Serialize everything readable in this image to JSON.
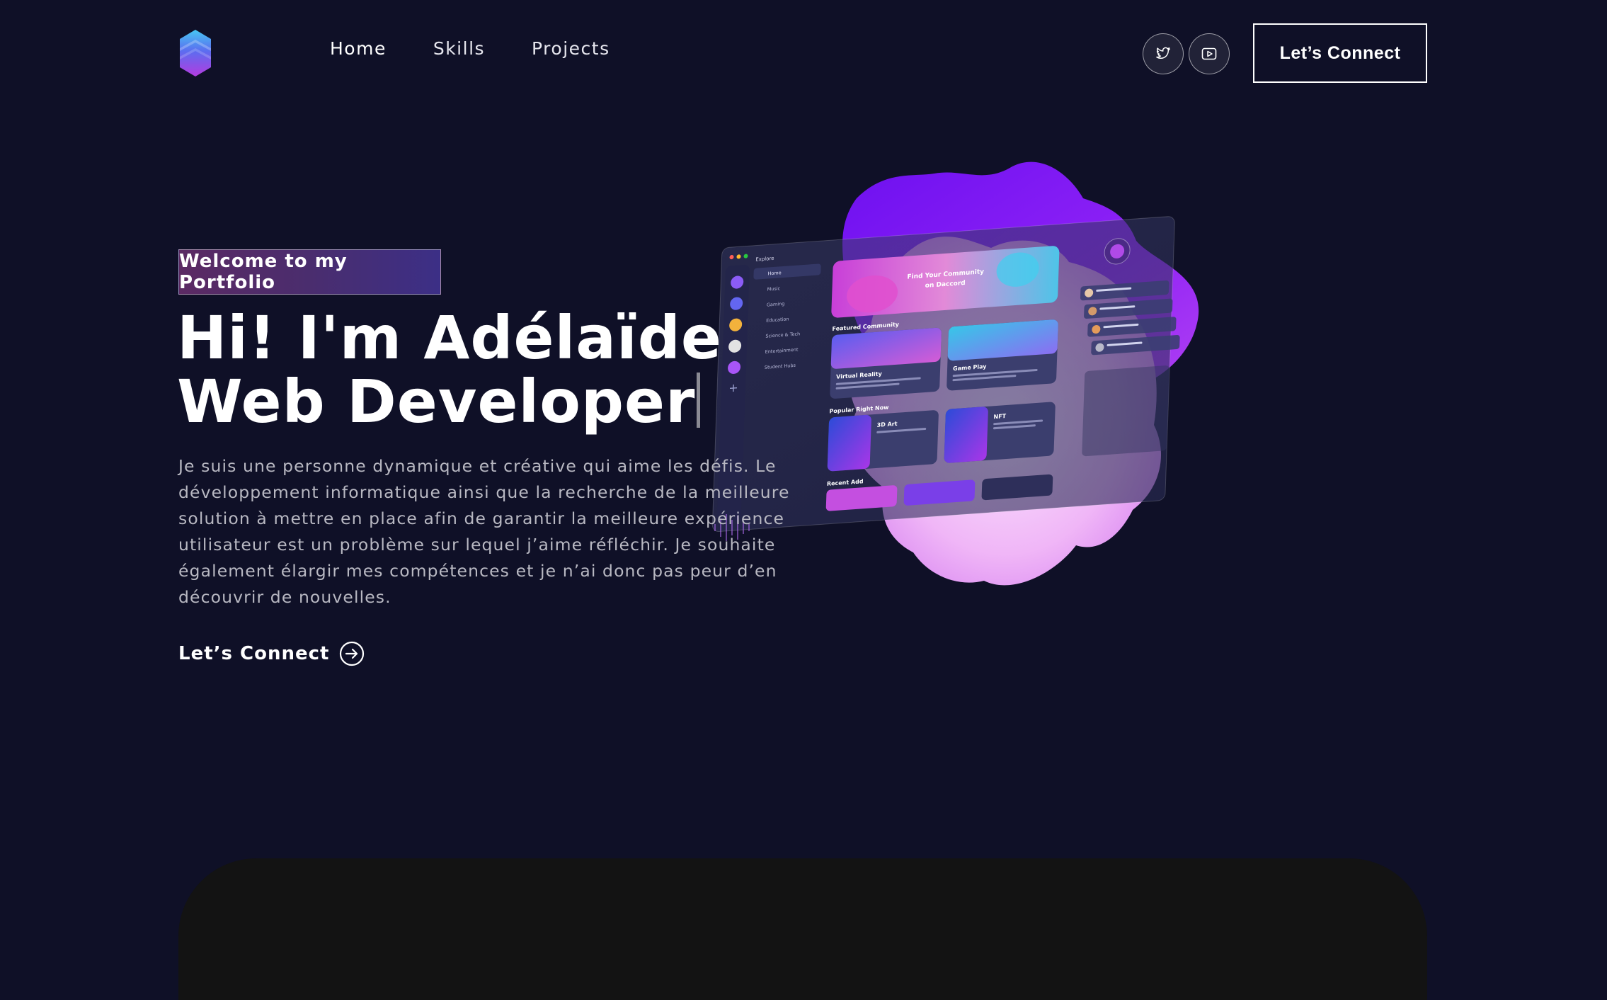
{
  "nav": {
    "links": [
      "Home",
      "Skills",
      "Projects"
    ],
    "social": [
      "twitter-icon",
      "youtube-icon"
    ],
    "cta": "Let’s Connect"
  },
  "hero": {
    "tagline": "Welcome to my Portfolio",
    "headline_line1": "Hi! I'm Adélaïde",
    "headline_line2": "Web Developer",
    "intro": "Je suis une personne dynamique et créative qui aime les défis. Le développement informatique ainsi que la recherche de la meilleure solution à mettre en place afin de garantir la meilleure expérience utilisateur est un problème sur lequel j’aime réfléchir. Je souhaite également élargir mes compétences et je n’ai donc pas peur d’en découvrir de nouvelles.",
    "cta": "Let’s Connect"
  },
  "mockup": {
    "banner_line1": "Find Your Community",
    "banner_line2": "on Daccord",
    "featured_title": "Featured Community",
    "card1": "Virtual Reality",
    "card2": "Game Play",
    "popular_title": "Popular Right Now",
    "card3": "3D Art",
    "card4": "NFT",
    "recent_title": "Recent Add",
    "sidebar": [
      "Home",
      "Music",
      "Gaming",
      "Education",
      "Science & Tech",
      "Entertainment",
      "Student Hubs"
    ]
  },
  "colors": {
    "background": "#0f1027",
    "blob_purple": "#8a1cf5",
    "blob_pink": "#e9a6f2",
    "accent": "#7b3fe4"
  }
}
